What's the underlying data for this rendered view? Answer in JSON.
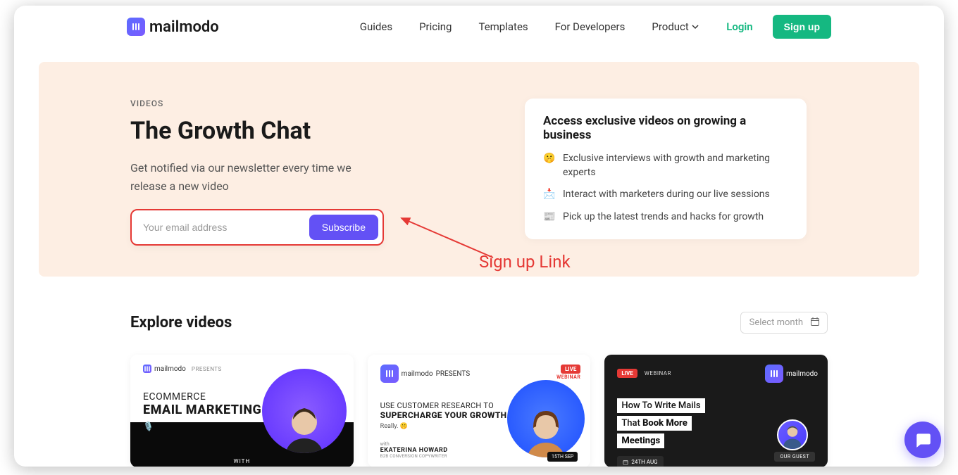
{
  "brand": "mailmodo",
  "nav": {
    "links": [
      "Guides",
      "Pricing",
      "Templates",
      "For Developers",
      "Product"
    ],
    "login": "Login",
    "signup": "Sign up"
  },
  "hero": {
    "eyebrow": "VIDEOS",
    "title": "The Growth Chat",
    "subtitle": "Get notified via our newsletter every time we release a new video",
    "email_placeholder": "Your email address",
    "subscribe": "Subscribe"
  },
  "benefits": {
    "heading": "Access exclusive videos on growing a business",
    "items": [
      {
        "emoji": "🤫",
        "text": "Exclusive interviews with growth and marketing experts"
      },
      {
        "emoji": "📩",
        "text": "Interact with marketers during our live sessions"
      },
      {
        "emoji": "📰",
        "text": "Pick up the latest trends and hacks for growth"
      }
    ]
  },
  "annotation": "Sign up Link",
  "explore": {
    "title": "Explore videos",
    "month_placeholder": "Select month"
  },
  "cards": {
    "c1": {
      "brand": "mailmodo",
      "presents": "PRESENTS",
      "line1": "ECOMMERCE",
      "line2": "EMAIL MARKETING",
      "with": "WITH"
    },
    "c2": {
      "brand": "mailmodo",
      "presents": "PRESENTS",
      "live": "LIVE",
      "webinar": "WEBINAR",
      "line1": "USE CUSTOMER RESEARCH TO",
      "line2": "SUPERCHARGE YOUR GROWTH.",
      "really": "Really. 🤫",
      "with": "with",
      "speaker": "EKATERINA HOWARD",
      "role": "B2B CONVERSION COPYWRITER",
      "date": "15TH SEP"
    },
    "c3": {
      "brand": "mailmodo",
      "live": "LIVE",
      "webinar": "WEBINAR",
      "l1a": "How To Write Mails",
      "l2a": "That ",
      "l2b": "Book More",
      "l3a": "Meetings",
      "date": "24TH AUG",
      "guest": "OUR GUEST"
    }
  }
}
